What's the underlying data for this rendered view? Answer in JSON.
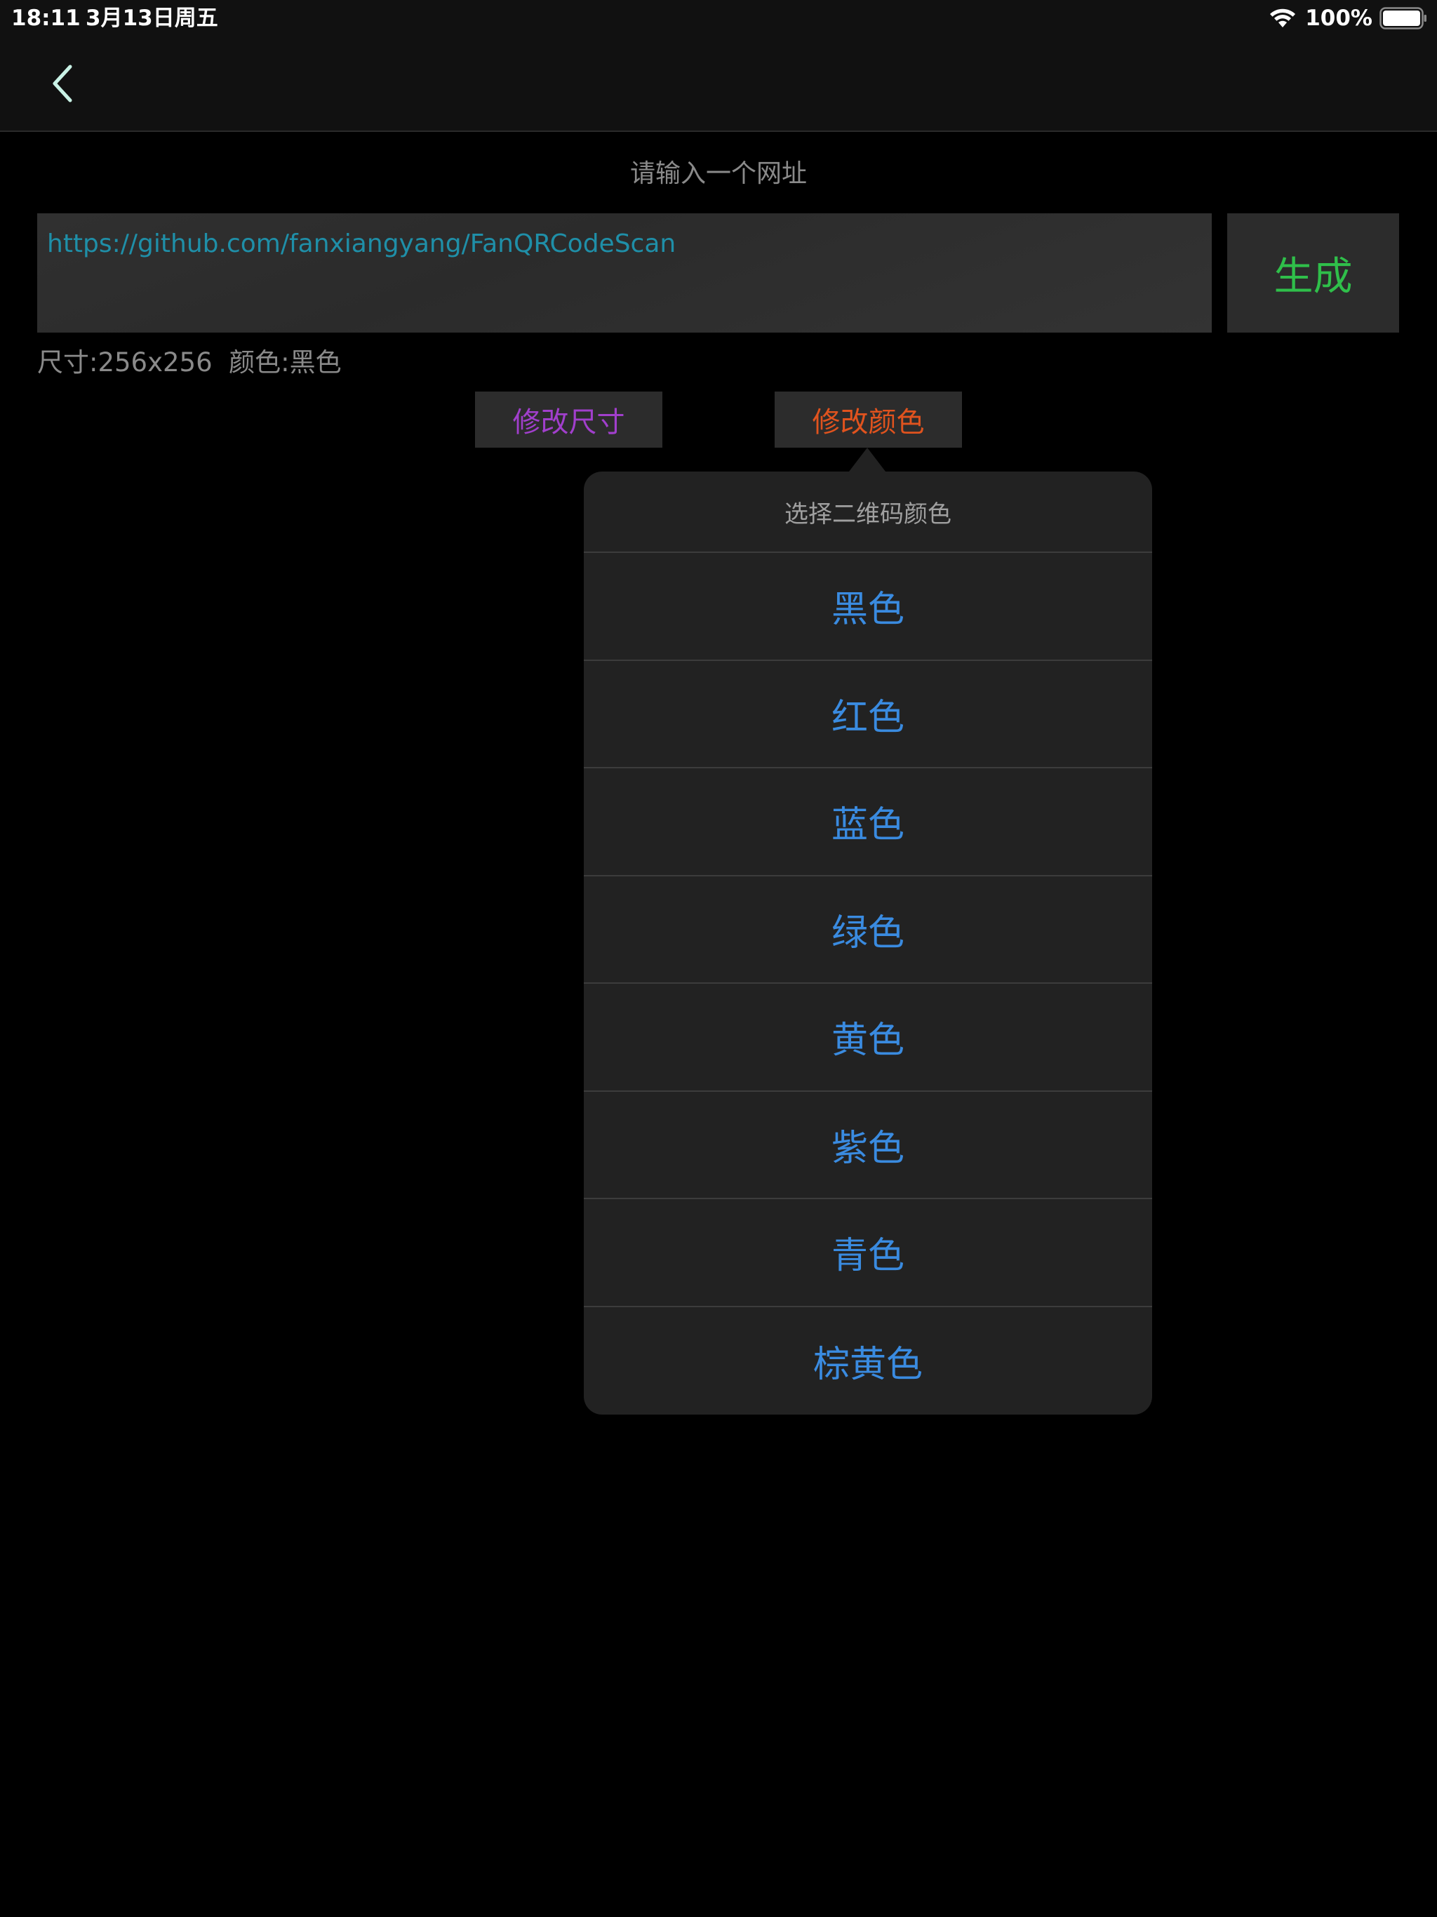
{
  "status_bar": {
    "time": "18:11",
    "date": "3月13日周五",
    "battery": "100%"
  },
  "nav": {
    "back_icon": "chevron-left-icon"
  },
  "form": {
    "prompt": "请输入一个网址",
    "url_value": "https://github.com/fanxiangyang/FanQRCodeScan",
    "generate_label": "生成",
    "info": "尺寸:256x256  颜色:黑色",
    "change_size_label": "修改尺寸",
    "change_color_label": "修改颜色"
  },
  "popover": {
    "title": "选择二维码颜色",
    "options": [
      "黑色",
      "红色",
      "蓝色",
      "绿色",
      "黄色",
      "紫色",
      "青色",
      "棕黄色"
    ]
  },
  "colors": {
    "background": "#000000",
    "bar": "#111111",
    "url_text": "#1f8fa8",
    "generate": "#2fbf4a",
    "size_button": "#a13fcc",
    "color_button": "#e0531e",
    "option_text": "#3a8be0"
  }
}
